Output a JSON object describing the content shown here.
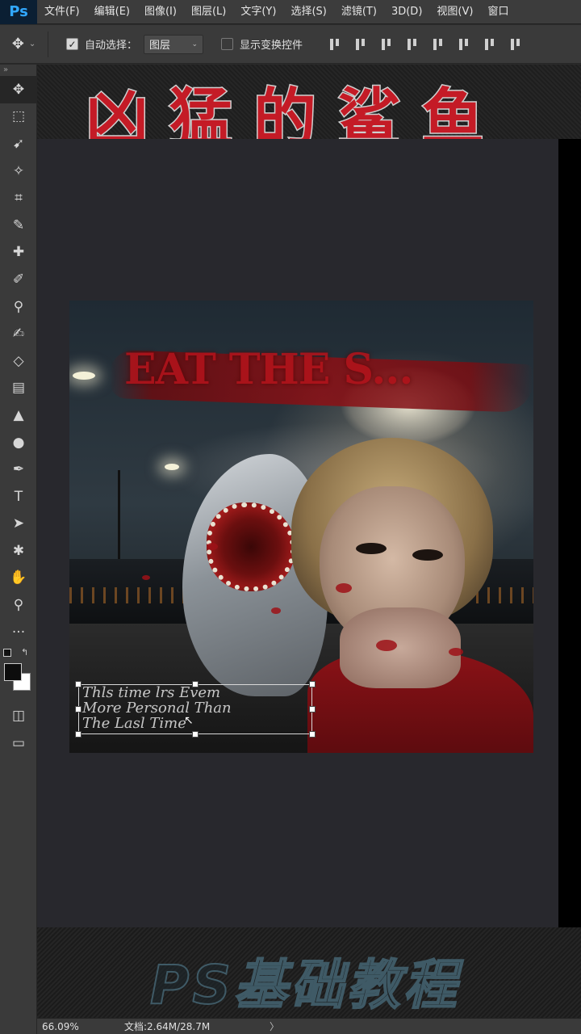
{
  "app": {
    "logo": "Ps"
  },
  "menu": [
    "文件(F)",
    "编辑(E)",
    "图像(I)",
    "图层(L)",
    "文字(Y)",
    "选择(S)",
    "滤镜(T)",
    "3D(D)",
    "视图(V)",
    "窗口"
  ],
  "options": {
    "move_icon": "✥",
    "auto_select_label": "自动选择：",
    "auto_select_checked": "✓",
    "layer_select_value": "图层",
    "show_transform_label": "显示变换控件"
  },
  "tools": {
    "collapse": "»",
    "items": [
      {
        "name": "move-tool-icon",
        "glyph": "✥"
      },
      {
        "name": "marquee-tool-icon",
        "glyph": "⬚"
      },
      {
        "name": "lasso-tool-icon",
        "glyph": "➹"
      },
      {
        "name": "magic-wand-icon",
        "glyph": "✧"
      },
      {
        "name": "crop-tool-icon",
        "glyph": "⌗"
      },
      {
        "name": "eyedropper-icon",
        "glyph": "✎"
      },
      {
        "name": "healing-brush-icon",
        "glyph": "✚"
      },
      {
        "name": "brush-tool-icon",
        "glyph": "✐"
      },
      {
        "name": "stamp-tool-icon",
        "glyph": "⚲"
      },
      {
        "name": "history-brush-icon",
        "glyph": "✍"
      },
      {
        "name": "eraser-icon",
        "glyph": "◇"
      },
      {
        "name": "gradient-tool-icon",
        "glyph": "▤"
      },
      {
        "name": "blur-tool-icon",
        "glyph": "▲"
      },
      {
        "name": "dodge-tool-icon",
        "glyph": "●"
      },
      {
        "name": "pen-tool-icon",
        "glyph": "✒"
      },
      {
        "name": "type-tool-icon",
        "glyph": "T"
      },
      {
        "name": "path-selection-icon",
        "glyph": "➤"
      },
      {
        "name": "shape-tool-icon",
        "glyph": "✱"
      },
      {
        "name": "hand-tool-icon",
        "glyph": "✋"
      },
      {
        "name": "zoom-tool-icon",
        "glyph": "⚲"
      },
      {
        "name": "more-tools-icon",
        "glyph": "···"
      }
    ],
    "bottom": [
      {
        "name": "quick-mask-icon",
        "glyph": "◫"
      },
      {
        "name": "screen-mode-icon",
        "glyph": "▭"
      }
    ],
    "swap_glyph": "↰"
  },
  "banner_top": {
    "title": "凶猛的鲨鱼"
  },
  "banner_bottom": {
    "title": "PS基础教程"
  },
  "artwork": {
    "headline": "EAT THE S...",
    "text_layer_lines": [
      "Thls time lrs Evem",
      "More Personal Than",
      "The Lasl Time"
    ]
  },
  "status": {
    "zoom": "66.09%",
    "doc_size": "文档:2.64M/28.7M",
    "arrow": "〉"
  }
}
